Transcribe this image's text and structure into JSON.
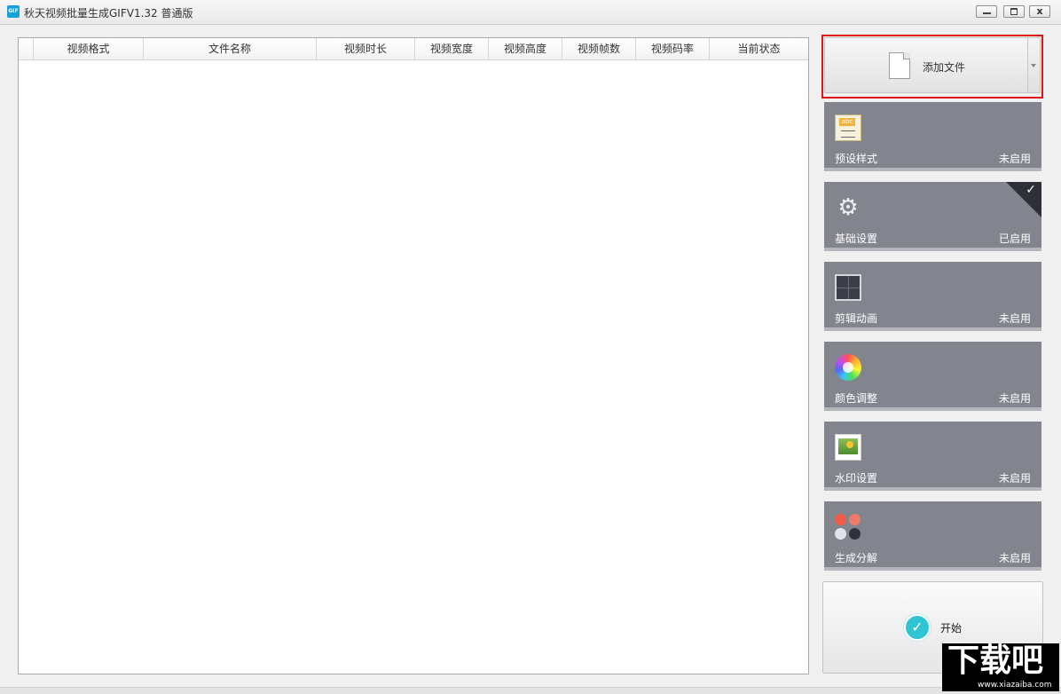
{
  "window": {
    "icon_text": "GIF",
    "title": "秋天视频批量生成GIFV1.32 普通版",
    "min_symbol": "",
    "close_symbol": "x"
  },
  "table": {
    "columns": [
      "视频格式",
      "文件名称",
      "视频时长",
      "视频宽度",
      "视频高度",
      "视频帧数",
      "视频码率",
      "当前状态"
    ],
    "rows": []
  },
  "add_file": {
    "label": "添加文件",
    "highlight_color": "#e0141a"
  },
  "panels": [
    {
      "label": "预设样式",
      "status": "未启用",
      "icon": "abc-text-icon",
      "active": false
    },
    {
      "label": "基础设置",
      "status": "已启用",
      "icon": "gear-icon",
      "active": true
    },
    {
      "label": "剪辑动画",
      "status": "未启用",
      "icon": "film-frame-icon",
      "active": false
    },
    {
      "label": "颜色调整",
      "status": "未启用",
      "icon": "color-wheel-icon",
      "active": false
    },
    {
      "label": "水印设置",
      "status": "未启用",
      "icon": "picture-icon",
      "active": false
    },
    {
      "label": "生成分解",
      "status": "未启用",
      "icon": "dots-icon",
      "active": false
    }
  ],
  "start": {
    "label": "开始",
    "icon": "check-circle-icon",
    "check_symbol": "✓"
  },
  "watermark": {
    "text": "下载吧",
    "url": "www.xiazaiba.com"
  },
  "colors": {
    "panel_bg": "#83858e",
    "accent": "#2ec4d3"
  }
}
